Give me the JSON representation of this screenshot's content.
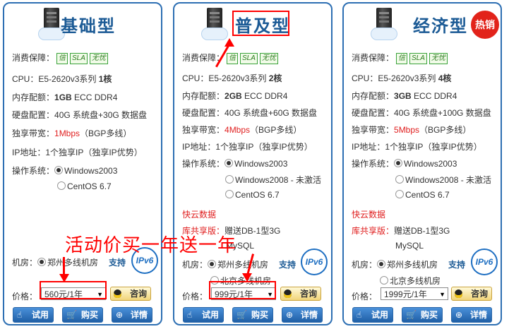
{
  "plans": [
    {
      "title": "基础型",
      "hot": "",
      "guarantee_label": "消费保障：",
      "badges": [
        "信",
        "SLA",
        "无忧"
      ],
      "cpu": {
        "prefix": "CPU：E5-2620v3系列 ",
        "value": "1核"
      },
      "memory": {
        "label": "内存配额：",
        "value": "1GB",
        "suffix": " ECC DDR4"
      },
      "disk": {
        "label": "硬盘配置：",
        "value": "40G 系统盘+30G 数据盘"
      },
      "bandwidth": {
        "label": "独享带宽：",
        "value": "1Mbps",
        "suffix": "（BGP多线）"
      },
      "ip": "IP地址：1个独享IP（独享IP优势）",
      "os_label": "操作系统：",
      "os_options": [
        "Windows2003",
        "CentOS 6.7"
      ],
      "room_label": "机房：",
      "rooms": [
        "郑州多线机房"
      ],
      "support_label": "支持",
      "ipv6": "IPv6",
      "price_label": "价格：",
      "price": "560元/1年",
      "consult": "咨询",
      "buttons": [
        "试用",
        "购买",
        "详情"
      ]
    },
    {
      "title": "普及型",
      "hot": "",
      "guarantee_label": "消费保障：",
      "badges": [
        "信",
        "SLA",
        "无忧"
      ],
      "cpu": {
        "prefix": "CPU：E5-2620v3系列 ",
        "value": "2核"
      },
      "memory": {
        "label": "内存配额：",
        "value": "2GB",
        "suffix": " ECC DDR4"
      },
      "disk": {
        "label": "硬盘配置：",
        "value": "40G 系统盘+60G 数据盘"
      },
      "bandwidth": {
        "label": "独享带宽：",
        "value": "4Mbps",
        "suffix": "（BGP多线）"
      },
      "ip": "IP地址：1个独享IP（独享IP优势）",
      "os_label": "操作系统：",
      "os_options": [
        "Windows2003",
        "Windows2008 - 未激活",
        "CentOS 6.7"
      ],
      "cloud_db": "快云数据",
      "db_label": "库共享版：",
      "db_value": "赠送DB-1型3G",
      "db_engine": "MySQL",
      "room_label": "机房：",
      "rooms": [
        "郑州多线机房",
        "北京多线机房"
      ],
      "support_label": "支持",
      "ipv6": "IPv6",
      "price_label": "价格：",
      "price": "999元/1年",
      "consult": "咨询",
      "buttons": [
        "试用",
        "购买",
        "详情"
      ]
    },
    {
      "title": "经济型",
      "hot": "热销",
      "guarantee_label": "消费保障：",
      "badges": [
        "信",
        "SLA",
        "无忧"
      ],
      "cpu": {
        "prefix": "CPU：E5-2620v3系列 ",
        "value": "4核"
      },
      "memory": {
        "label": "内存配额：",
        "value": "3GB",
        "suffix": " ECC DDR4"
      },
      "disk": {
        "label": "硬盘配置：",
        "value": "40G 系统盘+100G 数据盘"
      },
      "bandwidth": {
        "label": "独享带宽：",
        "value": "5Mbps",
        "suffix": "（BGP多线）"
      },
      "ip": "IP地址：1个独享IP（独享IP优势）",
      "os_label": "操作系统：",
      "os_options": [
        "Windows2003",
        "Windows2008 - 未激活",
        "CentOS 6.7"
      ],
      "cloud_db": "快云数据",
      "db_label": "库共享版：",
      "db_value": "赠送DB-1型3G",
      "db_engine": "MySQL",
      "room_label": "机房：",
      "rooms": [
        "郑州多线机房",
        "北京多线机房"
      ],
      "support_label": "支持",
      "ipv6": "IPv6",
      "price_label": "价格：",
      "price": "1999元/1年",
      "consult": "咨询",
      "buttons": [
        "试用",
        "购买",
        "详情"
      ]
    }
  ],
  "annotation": {
    "text": "活动价买一年送一年",
    "color": "#ff0000"
  },
  "colors": {
    "border": "#2d6fb3",
    "title": "#1b5a95",
    "red": "#e02020",
    "button": "#1f5fa6"
  }
}
